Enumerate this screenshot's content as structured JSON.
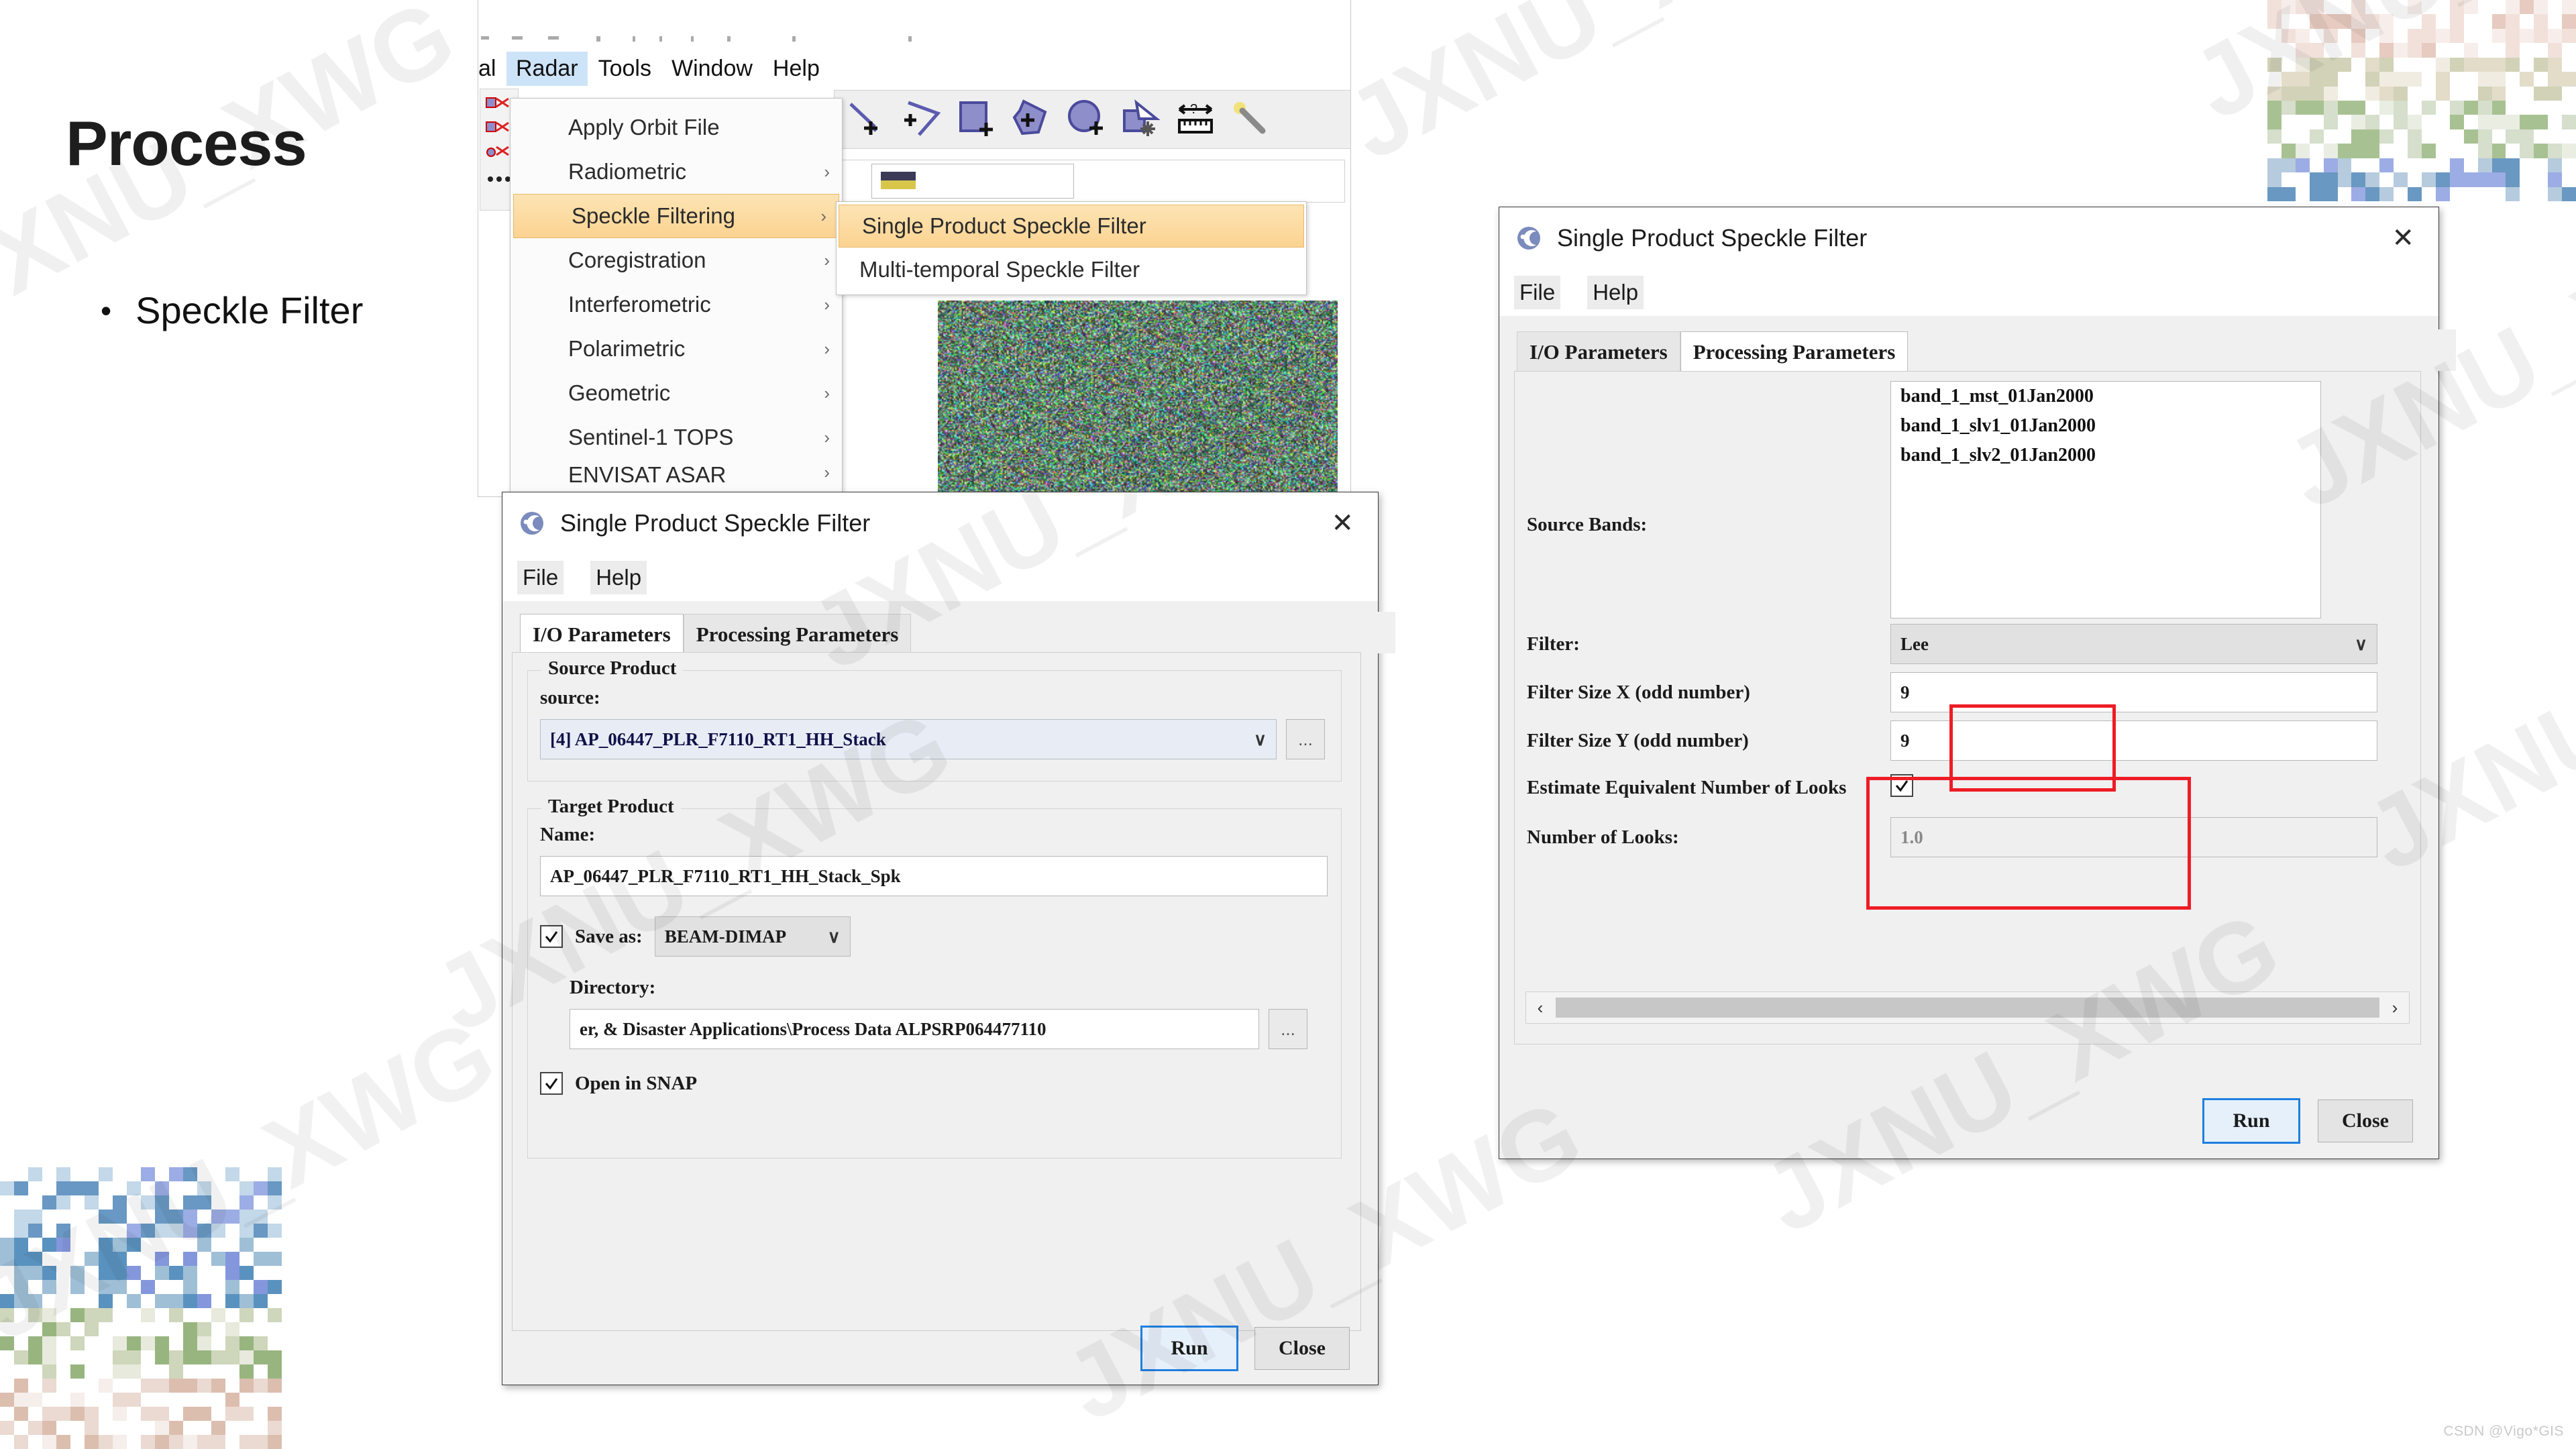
{
  "slide": {
    "title": "Process",
    "bullet_marker": "•",
    "bullet_text": "Speckle Filter",
    "credit": "CSDN @Vigo*GIS",
    "watermarks": [
      "JXNU_XWG",
      "JXNU_XWG",
      "JXNU_XWG",
      "JXNU_XWG",
      "JXNU_XWG",
      "JXNU_XWG",
      "JXNU_XWG"
    ]
  },
  "snap_window": {
    "menubar": {
      "clipped_prefix": "al",
      "items": [
        "Radar",
        "Tools",
        "Window",
        "Help"
      ],
      "selected": "Radar"
    },
    "toolbar_icons": [
      "draw-line-icon",
      "draw-polyline-icon",
      "draw-rectangle-icon",
      "draw-polygon-icon",
      "draw-ellipse-icon",
      "magic-wand-select-icon",
      "range-measure-icon",
      "pin-wand-icon"
    ]
  },
  "radar_menu": {
    "items": [
      {
        "label": "Apply Orbit File",
        "arrow": "",
        "highlight": false
      },
      {
        "label": "Radiometric",
        "arrow": "›",
        "highlight": false
      },
      {
        "label": "Speckle Filtering",
        "arrow": "›",
        "highlight": true
      },
      {
        "label": "Coregistration",
        "arrow": "›",
        "highlight": false
      },
      {
        "label": "Interferometric",
        "arrow": "›",
        "highlight": false
      },
      {
        "label": "Polarimetric",
        "arrow": "›",
        "highlight": false
      },
      {
        "label": "Geometric",
        "arrow": "›",
        "highlight": false
      },
      {
        "label": "Sentinel-1 TOPS",
        "arrow": "›",
        "highlight": false
      },
      {
        "label": "ENVISAT ASAR",
        "arrow": "›",
        "highlight": false
      }
    ],
    "submenu": [
      {
        "label": "Single Product Speckle Filter",
        "highlight": true
      },
      {
        "label": "Multi-temporal Speckle Filter",
        "highlight": false
      }
    ]
  },
  "dialog_io": {
    "title": "Single Product Speckle Filter",
    "close_glyph": "✕",
    "menu": [
      "File",
      "Help"
    ],
    "tabs": [
      {
        "label": "I/O Parameters",
        "active": true
      },
      {
        "label": "Processing Parameters",
        "active": false
      }
    ],
    "source_group_legend": "Source Product",
    "source_label": "source:",
    "source_value": "[4] AP_06447_PLR_F7110_RT1_HH_Stack",
    "source_browse": "...",
    "target_group_legend": "Target Product",
    "name_label": "Name:",
    "name_value": "AP_06447_PLR_F7110_RT1_HH_Stack_Spk",
    "save_as_label": "Save as:",
    "save_as_checked": true,
    "save_as_format": "BEAM-DIMAP",
    "directory_label": "Directory:",
    "directory_value": "er, & Disaster Applications\\Process Data ALPSRP064477110",
    "directory_browse": "...",
    "open_in_snap_label": "Open in SNAP",
    "open_in_snap_checked": true,
    "run_label": "Run",
    "close_label": "Close"
  },
  "dialog_proc": {
    "title": "Single Product Speckle Filter",
    "close_glyph": "✕",
    "menu": [
      "File",
      "Help"
    ],
    "tabs": [
      {
        "label": "I/O Parameters",
        "active": false
      },
      {
        "label": "Processing Parameters",
        "active": true
      }
    ],
    "source_bands_label": "Source Bands:",
    "source_bands": [
      "band_1_mst_01Jan2000",
      "band_1_slv1_01Jan2000",
      "band_1_slv2_01Jan2000"
    ],
    "filter_label": "Filter:",
    "filter_value": "Lee",
    "filter_size_x_label": "Filter Size X (odd number)",
    "filter_size_x_value": "9",
    "filter_size_y_label": "Filter Size Y (odd number)",
    "filter_size_y_value": "9",
    "estimate_enl_label": "Estimate Equivalent Number of Looks",
    "estimate_enl_checked": true,
    "number_of_looks_label": "Number of Looks:",
    "number_of_looks_value": "1.0",
    "scroll_left": "‹",
    "scroll_right": "›",
    "run_label": "Run",
    "close_label": "Close"
  },
  "colors": {
    "menu_highlight": "#fbd391",
    "menu_selected": "#cde3f7",
    "annotation_red": "#ee1c25",
    "primary_button_border": "#1f7fe0",
    "combo_field": "#e8edf5"
  }
}
